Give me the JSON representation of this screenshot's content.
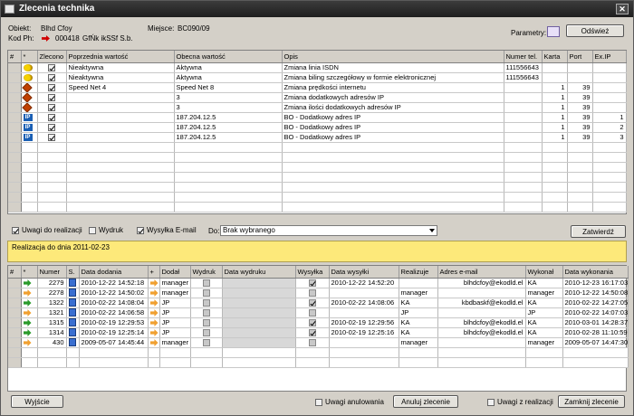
{
  "window": {
    "title": "Zlecenia technika"
  },
  "header": {
    "obiekt_label": "Obiekt:",
    "obiekt_value": "Blhd Cfoy",
    "miejsce_label": "Miejsce:",
    "miejsce_value": "BC090/09",
    "kod_label": "Kod Ph:",
    "kod_value": "000418",
    "kod_extra": "GfŃk ikSSf S.b.",
    "parametry_label": "Parametry:",
    "refresh_label": "Odśwież"
  },
  "orders_table": {
    "columns": [
      "#",
      "*",
      "Zlecono",
      "Poprzednia wartość",
      "Obecna wartość",
      "Opis",
      "Numer tel.",
      "Karta",
      "Port",
      "Ex.IP"
    ],
    "rows": [
      {
        "icon": "key-icon",
        "checked": true,
        "prev": "Nieaktywna",
        "curr": "Aktywna",
        "opis": "Zmiana linia ISDN",
        "tel": "111556643",
        "karta": "",
        "port": "",
        "exip": ""
      },
      {
        "icon": "key-icon",
        "checked": true,
        "prev": "Nieaktywna",
        "curr": "Aktywna",
        "opis": "Zmiana biling szczegółowy w formie elektronicznej",
        "tel": "111556643",
        "karta": "",
        "port": "",
        "exip": ""
      },
      {
        "icon": "diamond-icon",
        "checked": true,
        "prev": "Speed Net 4",
        "curr": "Speed Net 8",
        "opis": "Zmiana prędkości internetu",
        "tel": "",
        "karta": "1",
        "port": "39",
        "exip": ""
      },
      {
        "icon": "diamond-icon",
        "checked": true,
        "prev": "",
        "curr": "3",
        "opis": "Zmiana dodatkowych adresów IP",
        "tel": "",
        "karta": "1",
        "port": "39",
        "exip": ""
      },
      {
        "icon": "diamond-icon",
        "checked": true,
        "prev": "",
        "curr": "3",
        "opis": "Zmiana ilości dodatkowych adresów IP",
        "tel": "",
        "karta": "1",
        "port": "39",
        "exip": ""
      },
      {
        "icon": "ip-icon",
        "checked": true,
        "prev": "",
        "curr": "187.204.12.5",
        "opis": "BO - Dodatkowy adres IP",
        "tel": "",
        "karta": "1",
        "port": "39",
        "exip": "1"
      },
      {
        "icon": "ip-icon",
        "checked": true,
        "prev": "",
        "curr": "187.204.12.5",
        "opis": "BO - Dodatkowy adres IP",
        "tel": "",
        "karta": "1",
        "port": "39",
        "exip": "2"
      },
      {
        "icon": "ip-icon",
        "checked": true,
        "prev": "",
        "curr": "187.204.12.5",
        "opis": "BO - Dodatkowy adres IP",
        "tel": "",
        "karta": "1",
        "port": "39",
        "exip": "3"
      }
    ]
  },
  "options": {
    "uwagi_label": "Uwagi do realizacji",
    "uwagi_checked": true,
    "wydruk_label": "Wydruk",
    "wydruk_checked": false,
    "wysylka_label": "Wysyłka E-mail",
    "wysylka_checked": true,
    "do_label": "Do:",
    "do_value": "Brak wybranego",
    "approve_label": "Zatwierdź"
  },
  "note": {
    "text": "Realizacja do dnia 2011-02-23"
  },
  "history_table": {
    "columns": [
      "#",
      "*",
      "Numer",
      "S.",
      "Data dodania",
      "+",
      "Dodał",
      "Wydruk",
      "Data wydruku",
      "Wysyłka",
      "Data wysyłki",
      "Realizuje",
      "Adres e-mail",
      "Wykonał",
      "Data wykonania"
    ],
    "rows": [
      {
        "arrow": "green",
        "numer": "2279",
        "data_dodania": "2010-12-22 14:52:18",
        "dodal": "manager",
        "wydruk": false,
        "data_wydruku": "",
        "wysylka": true,
        "data_wysylki": "2010-12-22 14:52:20",
        "realizuje": "",
        "email": "blhdcfoy@ekodld.el",
        "wykonal": "KA",
        "data_wykonania": "2010-12-23 16:17:03"
      },
      {
        "arrow": "orange",
        "numer": "2278",
        "data_dodania": "2010-12-22 14:50:02",
        "dodal": "manager",
        "wydruk": false,
        "data_wydruku": "",
        "wysylka": false,
        "data_wysylki": "",
        "realizuje": "manager",
        "email": "",
        "wykonal": "manager",
        "data_wykonania": "2010-12-22 14:50:08"
      },
      {
        "arrow": "green",
        "numer": "1322",
        "data_dodania": "2010-02-22 14:08:04",
        "dodal": "JP",
        "wydruk": false,
        "data_wydruku": "",
        "wysylka": true,
        "data_wysylki": "2010-02-22 14:08:06",
        "realizuje": "KA",
        "email": "kbdbaskf@ekodld.el",
        "wykonal": "KA",
        "data_wykonania": "2010-02-22 14:27:05"
      },
      {
        "arrow": "orange",
        "numer": "1321",
        "data_dodania": "2010-02-22 14:06:58",
        "dodal": "JP",
        "wydruk": false,
        "data_wydruku": "",
        "wysylka": false,
        "data_wysylki": "",
        "realizuje": "JP",
        "email": "",
        "wykonal": "JP",
        "data_wykonania": "2010-02-22 14:07:03"
      },
      {
        "arrow": "green",
        "numer": "1315",
        "data_dodania": "2010-02-19 12:29:53",
        "dodal": "JP",
        "wydruk": false,
        "data_wydruku": "",
        "wysylka": true,
        "data_wysylki": "2010-02-19 12:29:56",
        "realizuje": "KA",
        "email": "blhdcfoy@ekodld.el",
        "wykonal": "KA",
        "data_wykonania": "2010-03-01 14:28:37"
      },
      {
        "arrow": "green",
        "numer": "1314",
        "data_dodania": "2010-02-19 12:25:14",
        "dodal": "JP",
        "wydruk": false,
        "data_wydruku": "",
        "wysylka": true,
        "data_wysylki": "2010-02-19 12:25:16",
        "realizuje": "KA",
        "email": "blhdcfoy@ekodld.el",
        "wykonal": "KA",
        "data_wykonania": "2010-02-28 11:10:59"
      },
      {
        "arrow": "orange",
        "numer": "430",
        "data_dodania": "2009-05-07 14:45:44",
        "dodal": "manager",
        "wydruk": false,
        "data_wydruku": "",
        "wysylka": false,
        "data_wysylki": "",
        "realizuje": "manager",
        "email": "",
        "wykonal": "manager",
        "data_wykonania": "2009-05-07 14:47:30"
      }
    ]
  },
  "footer": {
    "exit_label": "Wyjście",
    "uwagi_anulowania_label": "Uwagi anulowania",
    "uwagi_anulowania_checked": false,
    "cancel_order_label": "Anuluj zlecenie",
    "uwagi_realizacji_label": "Uwagi z realizacji",
    "uwagi_realizacji_checked": false,
    "close_order_label": "Zamknij zlecenie"
  },
  "colors": {
    "note_bg": "#fde97a",
    "title_bg": "#2a2a2a",
    "panel_bg": "#d4d0c8"
  }
}
